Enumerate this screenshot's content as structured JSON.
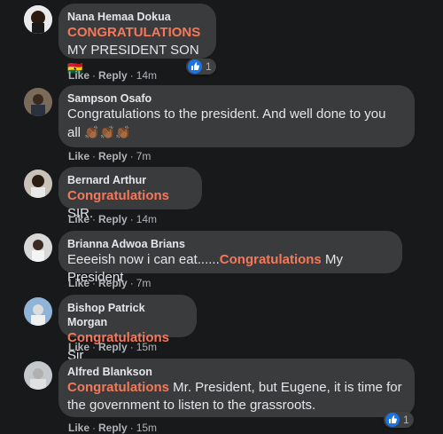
{
  "comments": [
    {
      "author": "Nana Hemaa Dokua",
      "highlight": "CONGRATULATIONS",
      "text_after": "MY PRESIDENT SON",
      "emoji": "🇬🇭",
      "like": "Like",
      "reply": "Reply",
      "time": "14m",
      "reactions": "1"
    },
    {
      "author": "Sampson Osafo",
      "text_line1": "Congratulations to the president. And well done to you",
      "text_line2": "all",
      "emoji": "👏🏾👏🏾👏🏾",
      "like": "Like",
      "reply": "Reply",
      "time": "7m"
    },
    {
      "author": "Bernard Arthur",
      "highlight": "Congratulations",
      "text_after": " SIR.",
      "like": "Like",
      "reply": "Reply",
      "time": "14m"
    },
    {
      "author": "Brianna Adwoa Brians",
      "text_before": "Eeeeish now i can eat......",
      "highlight": "Congratulations",
      "text_after": " My President",
      "like": "Like",
      "reply": "Reply",
      "time": "7m"
    },
    {
      "author": "Bishop Patrick Morgan",
      "highlight": "Congratulations",
      "text_after": " Sir",
      "like": "Like",
      "reply": "Reply",
      "time": "15m"
    },
    {
      "author": "Alfred Blankson",
      "highlight": "Congratulations",
      "text_after": " Mr. President, but Eugene, it is time for",
      "text_line2": "the government to listen to the grassroots.",
      "like": "Like",
      "reply": "Reply",
      "time": "15m",
      "reactions": "1"
    }
  ],
  "colors": {
    "background": "#18191a",
    "bubble": "#3a3b3c",
    "highlight": "#f5785a",
    "like_blue": "#1b74e4"
  }
}
